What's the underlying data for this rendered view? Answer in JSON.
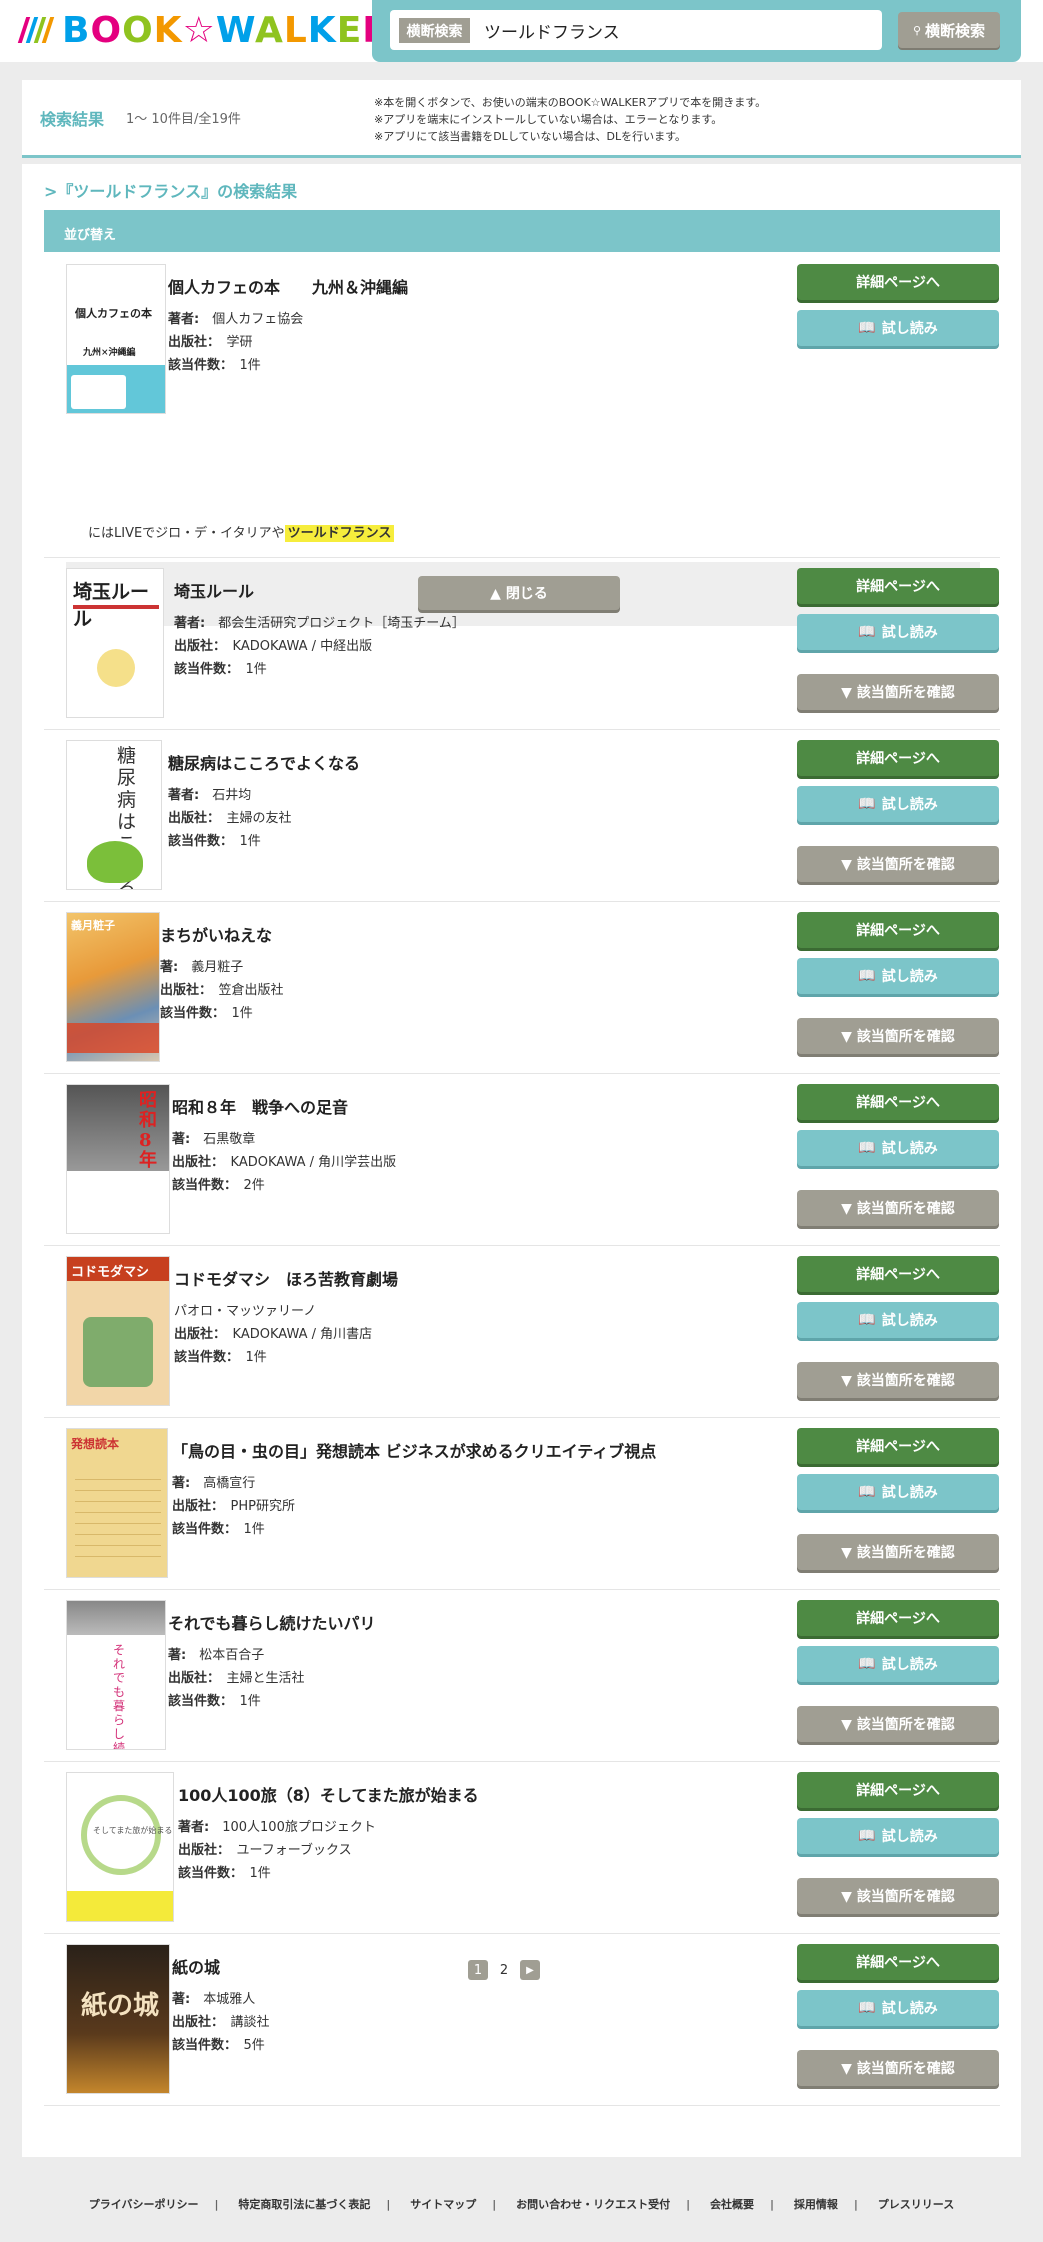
{
  "header": {
    "logo_text": "BOOK☆WALKER",
    "search_category": "横断検索",
    "search_value": "ツールドフランス",
    "search_button": "横断検索"
  },
  "result_bar": {
    "label": "検索結果",
    "count": "1〜 10件目/全19件",
    "notes": [
      "※本を開くボタンで、お使いの端末のBOOK☆WALKERアプリで本を開きます。",
      "※アプリを端末にインストールしていない場合は、エラーとなります。",
      "※アプリにて該当書籍をDLしていない場合は、DLを行います。"
    ]
  },
  "query_title": ">『ツールドフランス』の検索結果",
  "sort_label": "並び替え",
  "buttons": {
    "detail": "詳細ページへ",
    "trial": "試し読み",
    "check": "▼ 該当箇所を確認",
    "close": "▲ 閉じる"
  },
  "excerpt": {
    "text": "にはLIVEでジロ・デ・イタリアや",
    "highlight": "ツールドフランス"
  },
  "items": [
    {
      "title": "個人カフェの本　　九州＆沖縄編",
      "author_label": "著者:",
      "author": "個人カフェ協会",
      "publisher_label": "出版社：",
      "publisher": "学研",
      "hits_label": "該当件数：",
      "hits": "1件",
      "cover_text": "個人カフェの本",
      "cover_sub": "九州×沖縄編"
    },
    {
      "title": "埼玉ルール",
      "author_label": "著者:",
      "author": "都会生活研究プロジェクト［埼玉チーム］",
      "publisher_label": "出版社：",
      "publisher": "KADOKAWA / 中経出版",
      "hits_label": "該当件数：",
      "hits": "1件",
      "cover_text": "埼玉ルール"
    },
    {
      "title": "糖尿病はこころでよくなる",
      "author_label": "著者:",
      "author": "石井均",
      "publisher_label": "出版社：",
      "publisher": "主婦の友社",
      "hits_label": "該当件数：",
      "hits": "1件",
      "cover_text": "糖尿病はこころでよくなる"
    },
    {
      "title": "まちがいねえな",
      "author_label": "著:",
      "author": "義月粧子",
      "publisher_label": "出版社：",
      "publisher": "笠倉出版社",
      "hits_label": "該当件数：",
      "hits": "1件",
      "cover_text": "義月粧子"
    },
    {
      "title": "昭和８年　戦争への足音",
      "author_label": "著:",
      "author": "石黒敬章",
      "publisher_label": "出版社：",
      "publisher": "KADOKAWA / 角川学芸出版",
      "hits_label": "該当件数：",
      "hits": "2件",
      "cover_text": "昭和8年"
    },
    {
      "title": "コドモダマシ　ほろ苦教育劇場",
      "author_label": "",
      "author": "パオロ・マッツァリーノ",
      "publisher_label": "出版社：",
      "publisher": "KADOKAWA / 角川書店",
      "hits_label": "該当件数：",
      "hits": "1件",
      "cover_text": "コドモダマシ"
    },
    {
      "title": "「鳥の目・虫の目」発想読本 ビジネスが求めるクリエイティブ視点",
      "author_label": "著:",
      "author": "高橋宣行",
      "publisher_label": "出版社：",
      "publisher": "PHP研究所",
      "hits_label": "該当件数：",
      "hits": "1件",
      "cover_text": "発想読本"
    },
    {
      "title": "それでも暮らし続けたいパリ",
      "author_label": "著:",
      "author": "松本百合子",
      "publisher_label": "出版社：",
      "publisher": "主婦と生活社",
      "hits_label": "該当件数：",
      "hits": "1件",
      "cover_text": "それでも暮らし続けたいパリ"
    },
    {
      "title": "100人100旅（8）そしてまた旅が始まる",
      "author_label": "著者:",
      "author": "100人100旅プロジェクト",
      "publisher_label": "出版社：",
      "publisher": "ユーフォーブックス",
      "hits_label": "該当件数：",
      "hits": "1件",
      "cover_text": "そしてまた旅が始まる"
    },
    {
      "title": "紙の城",
      "author_label": "著:",
      "author": "本城雅人",
      "publisher_label": "出版社：",
      "publisher": "講談社",
      "hits_label": "該当件数：",
      "hits": "5件",
      "cover_text": "紙の城"
    }
  ],
  "pager": {
    "current": "1",
    "next_page": "2",
    "next_icon": "▶"
  },
  "footer": [
    "プライバシーポリシー",
    "特定商取引法に基づく表記",
    "サイトマップ",
    "お問い合わせ・リクエスト受付",
    "会社概要",
    "採用情報",
    "プレスリリース"
  ],
  "colors": {
    "accent": "#7cc5c9",
    "detail": "#4e8a44",
    "gray_button": "#a09e93",
    "highlight": "#f6ed3c"
  }
}
